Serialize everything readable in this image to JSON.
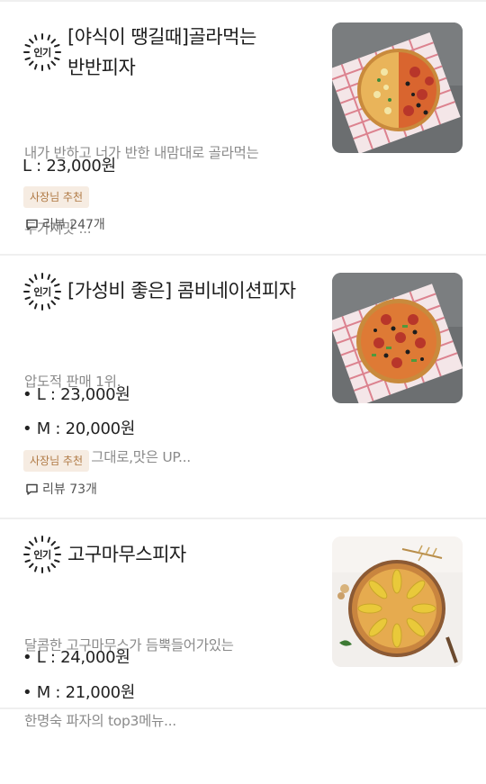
{
  "menu_items": [
    {
      "badge": "인기",
      "title_line1": "[야식이 땡길때]골라먹는",
      "title_line2": "반반피자",
      "desc_line1": "내가 반하고 너가 반한 내맘대로 골라먹는",
      "desc_line2": "두가지맛 ...",
      "prices": [
        "L : 23,000원"
      ],
      "recommend": "사장님 추천",
      "reviews": "리뷰 247개",
      "image_alt": "half-and-half pizza"
    },
    {
      "badge": "인기",
      "title_line1": "[가성비 좋은] 콤비네이션피자",
      "desc_line1": "압도적 판매 1위.",
      "desc_line2": "      가격은 그대로,맛은 UP...",
      "prices": [
        "• L : 23,000원",
        "• M : 20,000원"
      ],
      "recommend": "사장님 추천",
      "reviews": "리뷰 73개",
      "image_alt": "combination pizza"
    },
    {
      "badge": "인기",
      "title_line1": "고구마무스피자",
      "desc_line1": "달콤한 고구마무스가 듬뿍들어가있는",
      "desc_line2": "한명숙 파자의 top3메뉴...",
      "prices": [
        "• L : 24,000원",
        "• M : 21,000원"
      ],
      "image_alt": "sweet potato mousse pizza"
    }
  ],
  "colors": {
    "recommend_bg": "#f6ece2",
    "recommend_text": "#b07a45",
    "desc_text": "#8a8a8a"
  }
}
